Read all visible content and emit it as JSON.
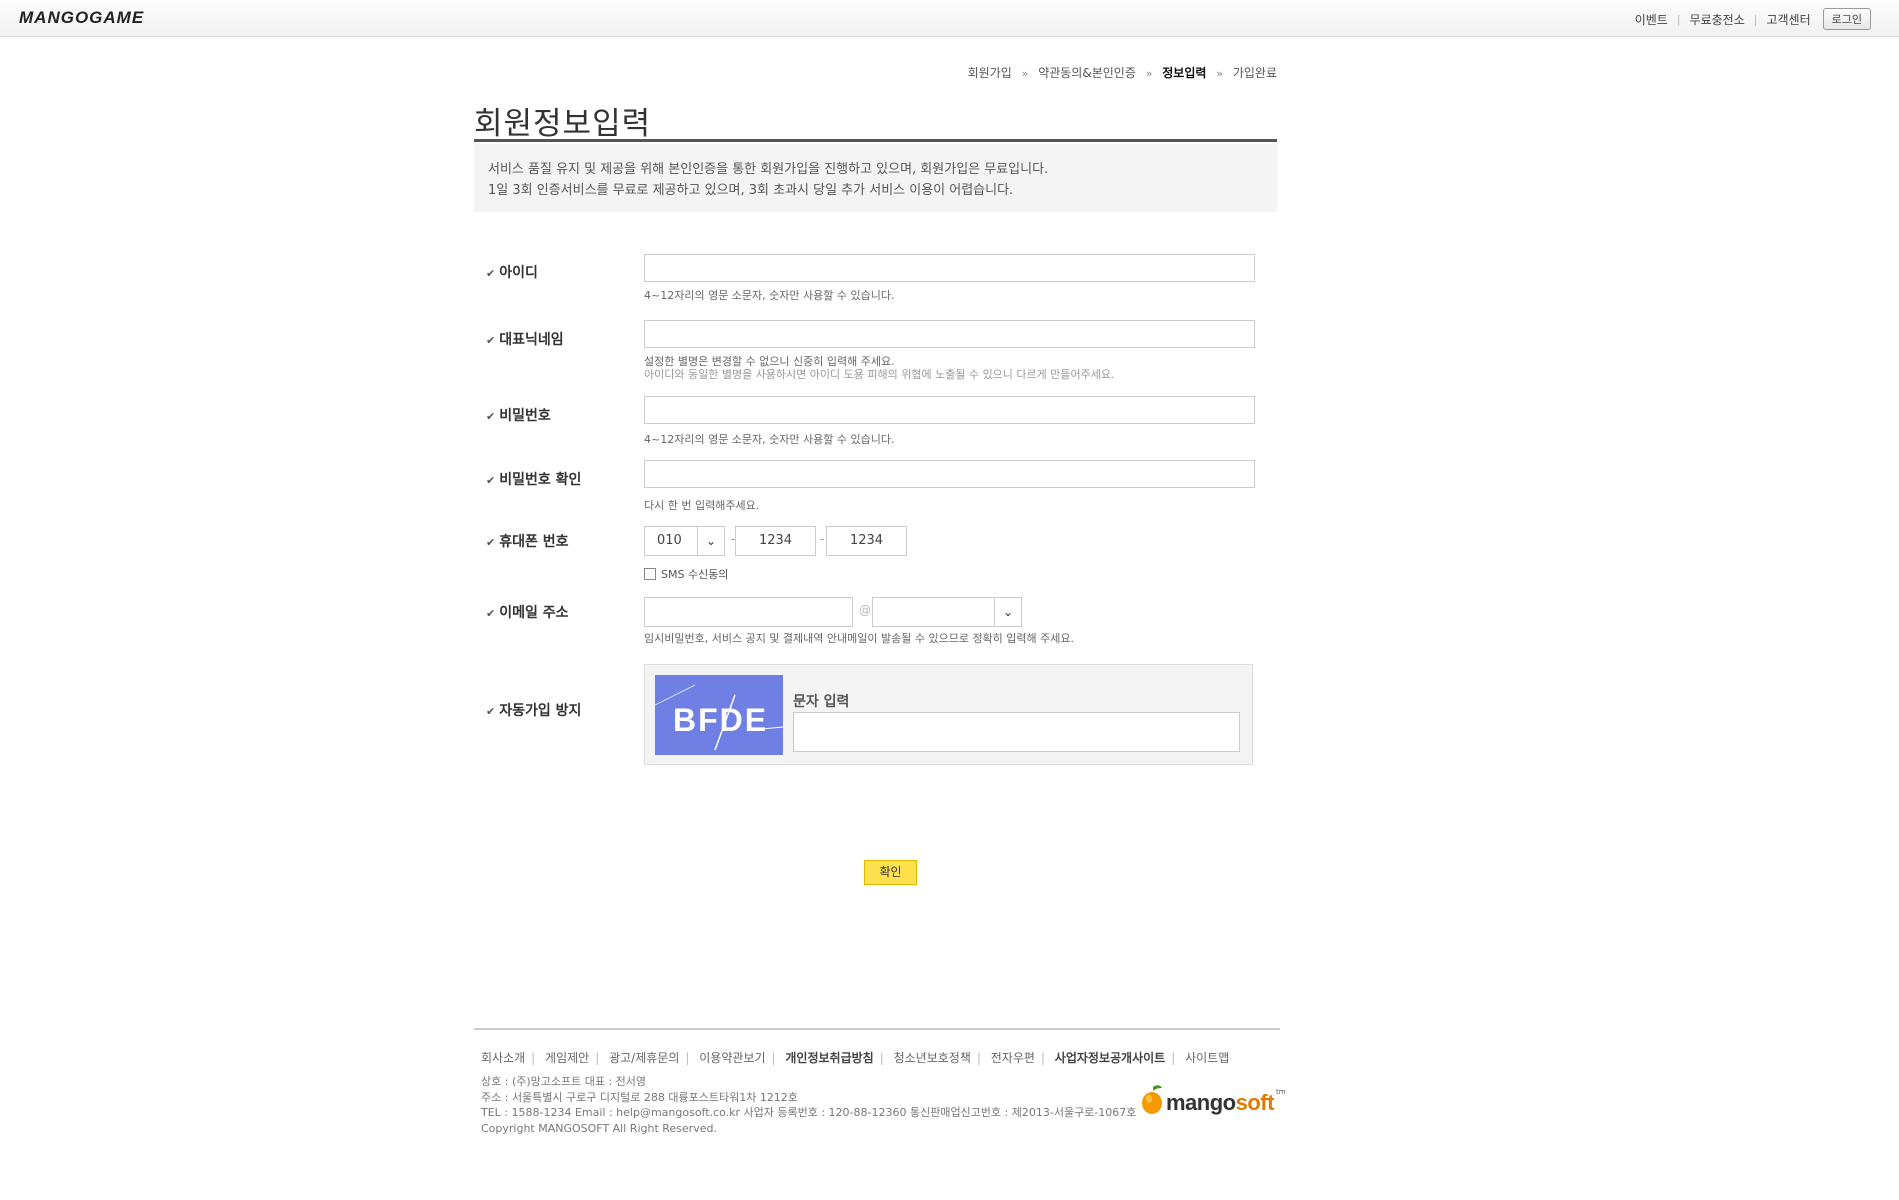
{
  "header": {
    "logo": "MANGOGAME",
    "nav": [
      "이벤트",
      "무료충전소",
      "고객센터"
    ],
    "login_label": "로그인"
  },
  "steps": {
    "items": [
      "회원가입",
      "약관동의&본인인증",
      "정보입력",
      "가입완료"
    ],
    "current_index": 2
  },
  "page_title": "회원정보입력",
  "notice": {
    "line1": "서비스 품질 유지 및 제공을 위해 본인인증을 통한 회원가입을 진행하고 있으며, 회원가입은 무료입니다.",
    "line2": "1일 3회 인증서비스를 무료로 제공하고 있으며, 3회 초과시 당일 추가 서비스 이용이 어렵습니다."
  },
  "form": {
    "id": {
      "label": "아이디",
      "hint": "4~12자리의 영문 소문자, 숫자만 사용할 수 있습니다.",
      "value": ""
    },
    "nickname": {
      "label": "대표닉네임",
      "hint1": "설정한 별명은 변경할 수 없으니 신중히 입력해 주세요.",
      "hint2": "아이디와 동일한 별명을 사용하시면 아이디 도용 피해의 위협에 노출될 수 있으니 다르게 만들어주세요.",
      "value": ""
    },
    "password": {
      "label": "비밀번호",
      "hint": "4~12자리의 영문 소문자, 숫자만 사용할 수 있습니다.",
      "value": ""
    },
    "password_confirm": {
      "label": "비밀번호 확인",
      "hint": "다시 한 번 입력해주세요.",
      "value": ""
    },
    "phone": {
      "label": "휴대폰 번호",
      "prefix": "010",
      "middle": "1234",
      "last": "1234",
      "sms_label": "SMS 수신동의",
      "sms_checked": false
    },
    "email": {
      "label": "이메일 주소",
      "at": "@",
      "user": "",
      "domain": "",
      "hint": "임시비밀번호, 서비스 공지 및 결제내역 안내메일이 발송될 수 있으므로 정확히 입력해 주세요."
    },
    "captcha": {
      "label": "자동가입 방지",
      "image_text": "BFDE",
      "input_label": "문자 입력",
      "value": ""
    }
  },
  "confirm_label": "확인",
  "footer": {
    "links": [
      "회사소개",
      "게임제안",
      "광고/제휴문의",
      "이용약관보기",
      "개인정보취급방침",
      "청소년보호정책",
      "전자우편",
      "사업자정보공개사이트",
      "사이트맵"
    ],
    "bold_links": [
      "개인정보취급방침",
      "사업자정보공개사이트"
    ],
    "info": [
      "상호 : (주)망고소프트 대표 : 전서영",
      "주소 : 서울특별시 구로구 디지털로 288 대륭포스트타워1차 1212호",
      "TEL : 1588-1234 Email : help@mangosoft.co.kr 사업자 등록번호 : 120-88-12360 통신판매업신고번호 : 제2013-서울구로-1067호",
      "Copyright MANGOSOFT All Right Reserved."
    ],
    "brand": {
      "main": "mango",
      "accent": "soft",
      "tm": "tm"
    }
  },
  "colors": {
    "confirm_button": "#ffe14d",
    "captcha_bg": "#6f7fe4",
    "title_rule": "#555555"
  }
}
